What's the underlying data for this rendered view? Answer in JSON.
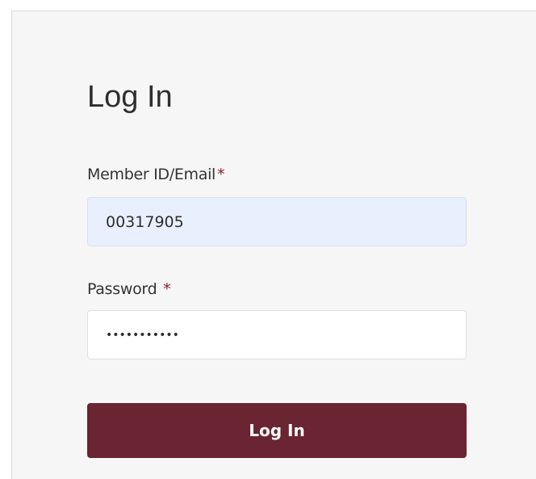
{
  "login": {
    "title": "Log In",
    "member_label": "Member ID/Email",
    "member_required": "*",
    "member_value": "00317905",
    "password_label": "Password",
    "password_required": "*",
    "password_value": "•••••••••••",
    "submit_label": "Log In"
  },
  "colors": {
    "button_bg": "#6b2431",
    "required_star": "#8a1c2b",
    "autofill_bg": "#e8f0fe",
    "card_bg": "#f6f6f6"
  }
}
